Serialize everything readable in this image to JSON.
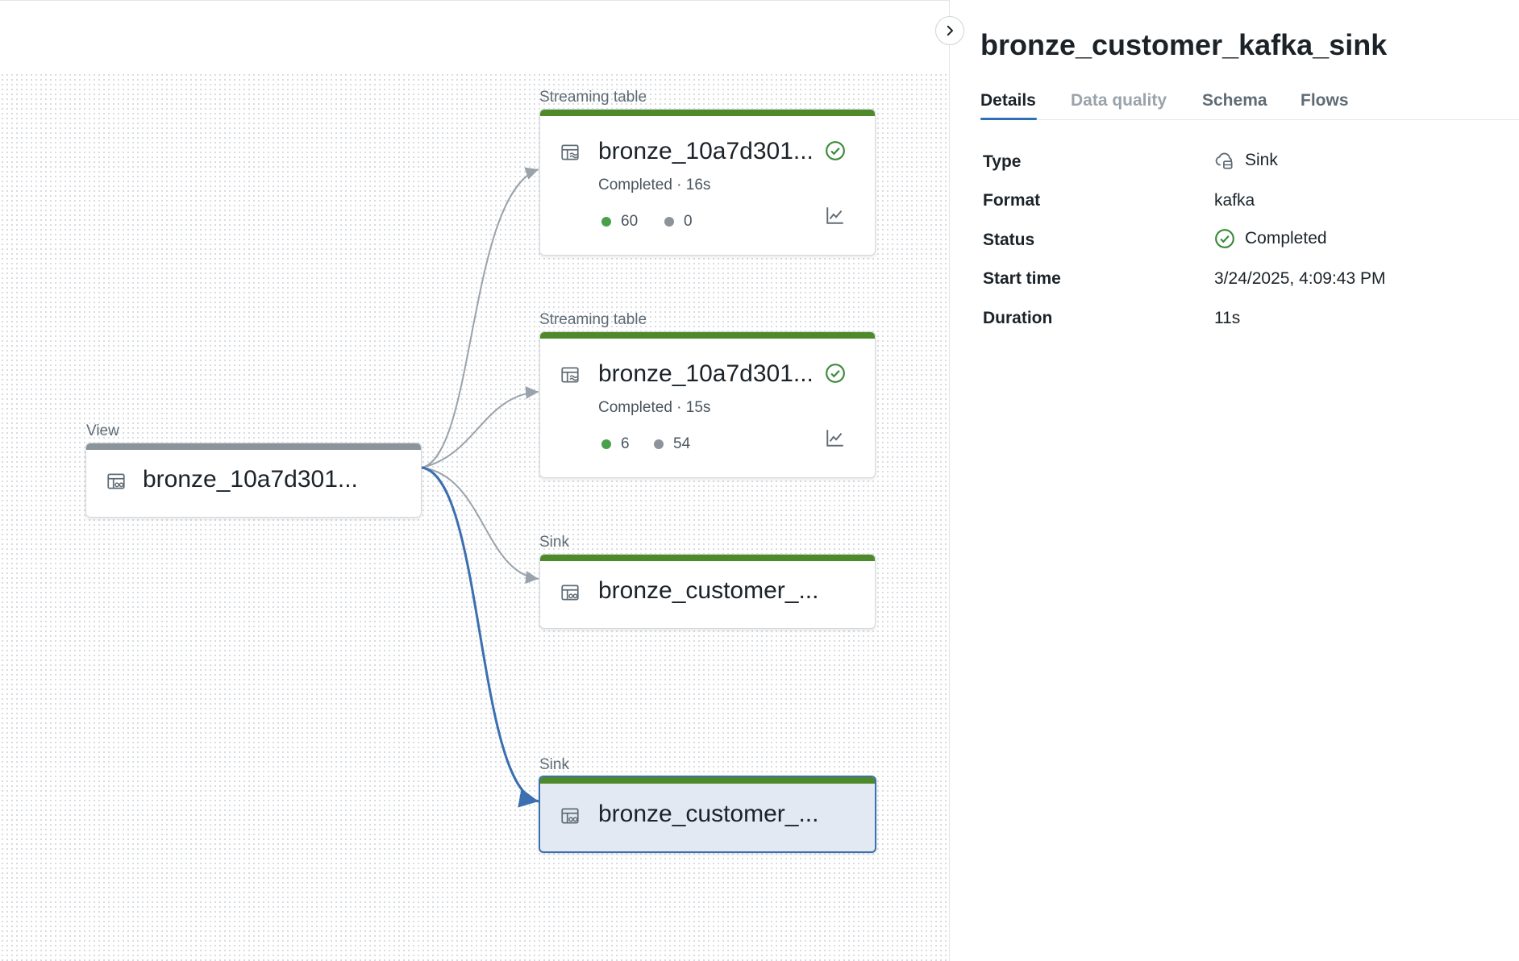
{
  "graph": {
    "nodes": [
      {
        "type_label": "Streaming table",
        "name": "bronze_10a7d301...",
        "status": "Completed · 16s",
        "metric_green": "60",
        "metric_gray": "0",
        "bar_color": "#4e8a2a"
      },
      {
        "type_label": "Streaming table",
        "name": "bronze_10a7d301...",
        "status": "Completed · 15s",
        "metric_green": "6",
        "metric_gray": "54",
        "bar_color": "#4e8a2a"
      },
      {
        "type_label": "View",
        "name": "bronze_10a7d301...",
        "bar_color": "#8b939b"
      },
      {
        "type_label": "Sink",
        "name": "bronze_customer_...",
        "bar_color": "#4e8a2a"
      },
      {
        "type_label": "Sink",
        "name": "bronze_customer_...",
        "bar_color": "#4e8a2a",
        "selected": true
      }
    ],
    "colors": {
      "success_green": "#4aa04a",
      "idle_gray": "#8b939b",
      "selected_edge": "#3b6fb0",
      "edge": "#9aa3ab"
    }
  },
  "panel": {
    "title": "bronze_customer_kafka_sink",
    "tabs": [
      {
        "label": "Details",
        "active": true
      },
      {
        "label": "Data quality",
        "disabled": true
      },
      {
        "label": "Schema"
      },
      {
        "label": "Flows"
      }
    ],
    "details": [
      {
        "label": "Type",
        "value": "Sink",
        "icon": "cloud-sink-icon"
      },
      {
        "label": "Format",
        "value": "kafka"
      },
      {
        "label": "Status",
        "value": "Completed",
        "icon": "check-circle-icon"
      },
      {
        "label": "Start time",
        "value": "3/24/2025, 4:09:43 PM"
      },
      {
        "label": "Duration",
        "value": "11s"
      }
    ]
  }
}
